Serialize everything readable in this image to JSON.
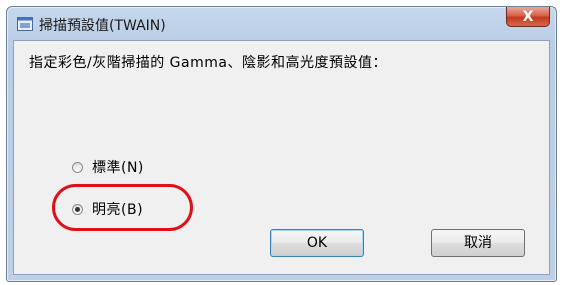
{
  "dialog": {
    "title": "掃描預設值(TWAIN)",
    "close_label": "X",
    "prompt": "指定彩色/灰階掃描的 Gamma、陰影和高光度預設值：",
    "options": [
      {
        "label": "標準(N)",
        "checked": false
      },
      {
        "label": "明亮(B)",
        "checked": true
      }
    ],
    "ok_label": "OK",
    "cancel_label": "取消"
  },
  "highlight_color": "#e0101a",
  "icons": {
    "app": "scanner-window-icon",
    "close": "close-icon"
  }
}
